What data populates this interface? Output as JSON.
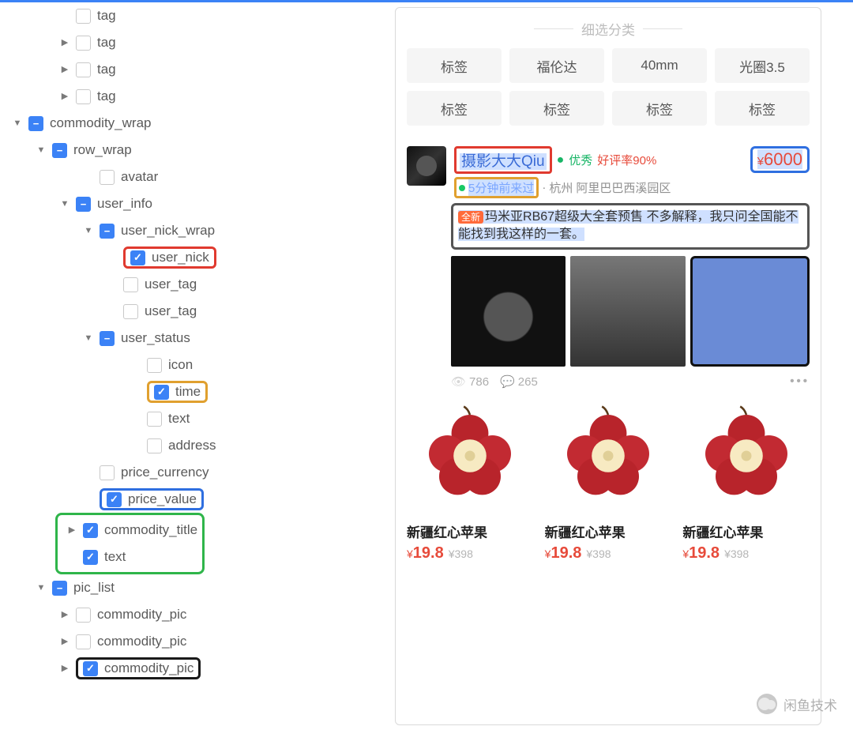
{
  "tree": [
    {
      "lvl": 2,
      "caret": "",
      "check": "off",
      "label": "tag"
    },
    {
      "lvl": 2,
      "caret": "▶",
      "check": "off",
      "label": "tag"
    },
    {
      "lvl": 2,
      "caret": "▶",
      "check": "off",
      "label": "tag"
    },
    {
      "lvl": 2,
      "caret": "▶",
      "check": "off",
      "label": "tag"
    },
    {
      "lvl": 0,
      "caret": "▼",
      "check": "minus",
      "label": "commodity_wrap"
    },
    {
      "lvl": 1,
      "caret": "▼",
      "check": "minus",
      "label": "row_wrap"
    },
    {
      "lvl": 3,
      "caret": "",
      "check": "off",
      "label": "avatar"
    },
    {
      "lvl": 2,
      "caret": "▼",
      "check": "minus",
      "label": "user_info"
    },
    {
      "lvl": 3,
      "caret": "▼",
      "check": "minus",
      "label": "user_nick_wrap"
    },
    {
      "lvl": 4,
      "caret": "",
      "check": "on",
      "label": "user_nick",
      "hl": "red"
    },
    {
      "lvl": 4,
      "caret": "",
      "check": "off",
      "label": "user_tag"
    },
    {
      "lvl": 4,
      "caret": "",
      "check": "off",
      "label": "user_tag"
    },
    {
      "lvl": 3,
      "caret": "▼",
      "check": "minus",
      "label": "user_status"
    },
    {
      "lvl": 5,
      "caret": "",
      "check": "off",
      "label": "icon"
    },
    {
      "lvl": 5,
      "caret": "",
      "check": "on",
      "label": "time",
      "hl": "orange"
    },
    {
      "lvl": 5,
      "caret": "",
      "check": "off",
      "label": "text"
    },
    {
      "lvl": 5,
      "caret": "",
      "check": "off",
      "label": "address"
    },
    {
      "lvl": 3,
      "caret": "",
      "check": "off",
      "label": "price_currency"
    },
    {
      "lvl": 3,
      "caret": "",
      "check": "on",
      "label": "price_value",
      "hl": "blue"
    },
    {
      "lvl": 2,
      "caret": "▶",
      "check": "on",
      "label": "commodity_title",
      "grp": "start"
    },
    {
      "lvl": 2,
      "caret": "",
      "check": "on",
      "label": "text",
      "grp": "end"
    },
    {
      "lvl": 1,
      "caret": "▼",
      "check": "minus",
      "label": "pic_list"
    },
    {
      "lvl": 2,
      "caret": "▶",
      "check": "off",
      "label": "commodity_pic"
    },
    {
      "lvl": 2,
      "caret": "▶",
      "check": "off",
      "label": "commodity_pic"
    },
    {
      "lvl": 2,
      "caret": "▶",
      "check": "on",
      "label": "commodity_pic",
      "hl": "black"
    }
  ],
  "app": {
    "cat_title": "细选分类",
    "tags": [
      "标签",
      "福伦达",
      "40mm",
      "光圈3.5",
      "标签",
      "标签",
      "标签",
      "标签"
    ],
    "post": {
      "nick": "摄影大大Qiu",
      "excellent": "优秀",
      "rating": "好评率90%",
      "price_currency": "¥",
      "price_value": "6000",
      "time": "5分钟前来过",
      "sep": "·",
      "city": "杭州",
      "address": "阿里巴巴西溪园区",
      "new_tag": "全新",
      "desc": "玛米亚RB67超级大全套预售 不多解释，我只问全国能不能找到我这样的一套。",
      "views": "786",
      "comments": "265",
      "more": "•••"
    },
    "products": [
      {
        "title": "新疆红心苹果",
        "price": "19.8",
        "old": "¥398",
        "cur": "¥"
      },
      {
        "title": "新疆红心苹果",
        "price": "19.8",
        "old": "¥398",
        "cur": "¥"
      },
      {
        "title": "新疆红心苹果",
        "price": "19.8",
        "old": "¥398",
        "cur": "¥"
      }
    ]
  },
  "watermark": "闲鱼技术"
}
